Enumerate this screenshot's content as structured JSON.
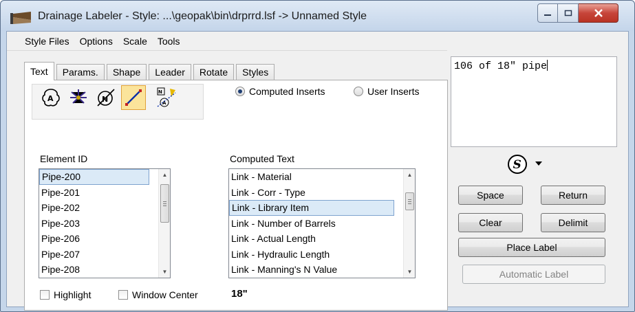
{
  "window": {
    "title": "Drainage Labeler - Style: ...\\geopak\\bin\\drprrd.lsf -> Unnamed Style"
  },
  "menu": {
    "items": [
      "Style Files",
      "Options",
      "Scale",
      "Tools"
    ]
  },
  "tabs": [
    "Text",
    "Params.",
    "Shape",
    "Leader",
    "Rotate",
    "Styles"
  ],
  "active_tab": "Text",
  "element_types": [
    "node-label-icon",
    "inlet-label-icon",
    "null-structure-icon",
    "link-pipe-icon",
    "label-edit-icon"
  ],
  "selected_element_type": "link-pipe-icon",
  "inserts": {
    "computed_label": "Computed Inserts",
    "user_label": "User Inserts",
    "selected": "Computed Inserts"
  },
  "element_id": {
    "label": "Element ID",
    "items": [
      "Pipe-200",
      "Pipe-201",
      "Pipe-202",
      "Pipe-203",
      "Pipe-206",
      "Pipe-207",
      "Pipe-208"
    ],
    "selected": "Pipe-200"
  },
  "computed_text": {
    "label": "Computed Text",
    "items": [
      "Link - Material",
      "Link - Corr - Type",
      "Link - Library Item",
      "Link - Number of Barrels",
      "Link - Actual Length",
      "Link - Hydraulic Length",
      "Link - Manning's N Value"
    ],
    "selected": "Link - Library Item"
  },
  "options": {
    "highlight_label": "Highlight",
    "window_center_label": "Window Center",
    "preview_value": "18\""
  },
  "label_text": "106 of 18\" pipe",
  "buttons": {
    "space": "Space",
    "return": "Return",
    "clear": "Clear",
    "delimit": "Delimit",
    "place_label": "Place Label",
    "automatic_label": "Automatic Label"
  },
  "colors": {
    "accent": "#1f3f73",
    "selected_row": "#dbeaf7",
    "selected_tool": "#fbe49b"
  }
}
